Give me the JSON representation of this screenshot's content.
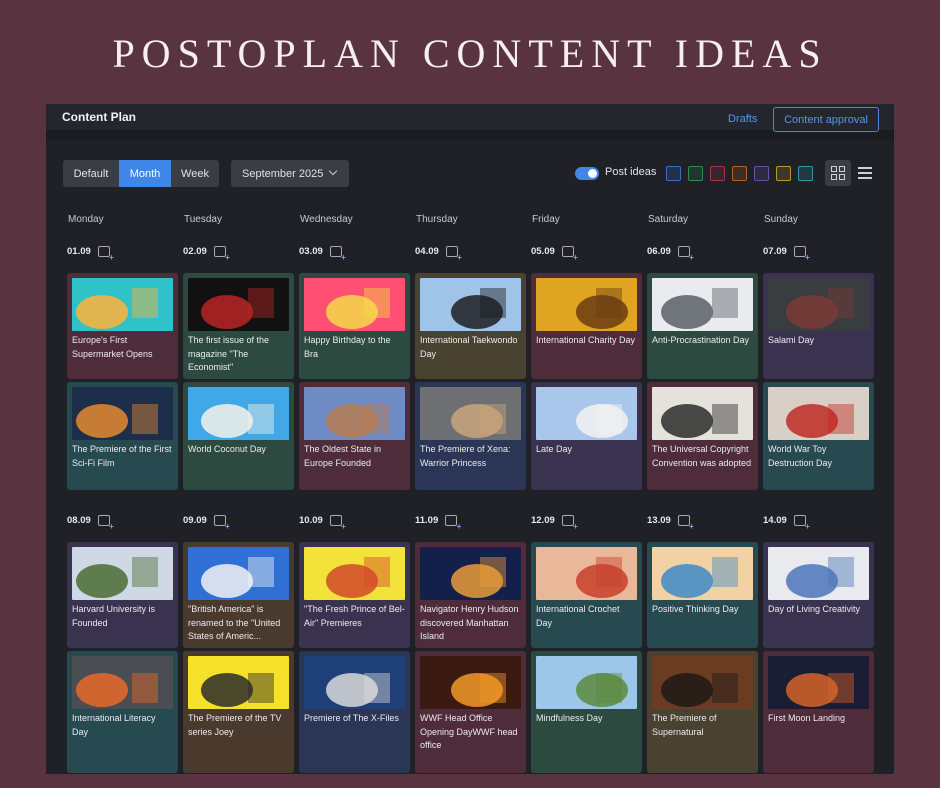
{
  "banner": {
    "text": "POSTOPLAN CONTENT IDEAS"
  },
  "header": {
    "title": "Content Plan",
    "drafts": "Drafts",
    "approval": "Content approval"
  },
  "toolbar": {
    "views": [
      "Default",
      "Month",
      "Week"
    ],
    "active_view": "Month",
    "month": "September 2025",
    "post_ideas_label": "Post ideas",
    "post_ideas_on": true,
    "swatches": [
      "#3a6fc4",
      "#2f8a4f",
      "#a33445",
      "#b4632f",
      "#6650a8",
      "#b89830",
      "#2e9aa8"
    ]
  },
  "days": [
    "Monday",
    "Tuesday",
    "Wednesday",
    "Thursday",
    "Friday",
    "Saturday",
    "Sunday"
  ],
  "weeks": [
    {
      "dates": [
        "01.09",
        "02.09",
        "03.09",
        "04.09",
        "05.09",
        "06.09",
        "07.09"
      ],
      "rows": [
        [
          {
            "text": "Europe's First Supermarket Opens",
            "color": "#4e2c3a",
            "img": [
              "#2fc3c9",
              "#ffb23a"
            ]
          },
          {
            "text": "The first issue of the magazine \"The Economist\"",
            "color": "#2d4a40",
            "img": [
              "#111111",
              "#b82424"
            ]
          },
          {
            "text": "Happy Birthday to the Bra",
            "color": "#2d4a40",
            "img": [
              "#ff4f72",
              "#f5d94a"
            ]
          },
          {
            "text": "International Taekwondo Day",
            "color": "#4a4230",
            "img": [
              "#9fc4e8",
              "#1d1f22"
            ]
          },
          {
            "text": "International Charity Day",
            "color": "#4e2c3a",
            "img": [
              "#e0a423",
              "#6b3d12"
            ]
          },
          {
            "text": "Anti-Procrastination Day",
            "color": "#2d4a40",
            "img": [
              "#e9ebef",
              "#5a5f66"
            ]
          },
          {
            "text": "Salami Day",
            "color": "#3a3350",
            "img": [
              "#3a3d40",
              "#7d3a35"
            ]
          }
        ],
        [
          {
            "text": "The Premiere of the First Sci-Fi Film",
            "color": "#274a50",
            "img": [
              "#1c2e4a",
              "#e58a32"
            ]
          },
          {
            "text": "World Coconut Day",
            "color": "#2d4a40",
            "img": [
              "#40a8e8",
              "#f4f1ea"
            ]
          },
          {
            "text": "The Oldest State in Europe Founded",
            "color": "#4e2c3a",
            "img": [
              "#6e8bc4",
              "#b87c55"
            ]
          },
          {
            "text": "The Premiere of Xena: Warrior Princess",
            "color": "#2b3556",
            "img": [
              "#6d6f72",
              "#c9a47d"
            ]
          },
          {
            "text": "Late Day",
            "color": "#3a3350",
            "img": [
              "#a9c7ea",
              "#f2f2f2"
            ]
          },
          {
            "text": "The Universal Copyright Convention was adopted",
            "color": "#4e2c3a",
            "img": [
              "#e5e2dc",
              "#2b2b2b"
            ]
          },
          {
            "text": "World War Toy Destruction Day",
            "color": "#274a50",
            "img": [
              "#d8cfc6",
              "#c02a24"
            ]
          }
        ]
      ]
    },
    {
      "dates": [
        "08.09",
        "09.09",
        "10.09",
        "11.09",
        "12.09",
        "13.09",
        "14.09"
      ],
      "rows": [
        [
          {
            "text": "Harvard University is Founded",
            "color": "#3a3350",
            "img": [
              "#cfd9e6",
              "#4b6b34"
            ]
          },
          {
            "text": "\"British America\" is renamed to the \"United States of Americ...",
            "color": "#4a3a2e",
            "img": [
              "#2f6fd6",
              "#f2f2f2"
            ]
          },
          {
            "text": "\"The Fresh Prince of Bel-Air\" Premieres",
            "color": "#3a3350",
            "img": [
              "#f2e23a",
              "#d24a2a"
            ]
          },
          {
            "text": "Navigator Henry Hudson discovered Manhattan Island",
            "color": "#4e2c3a",
            "img": [
              "#13214a",
              "#e99b3a"
            ]
          },
          {
            "text": "International Crochet Day",
            "color": "#274a50",
            "img": [
              "#e9b89a",
              "#c8402a"
            ]
          },
          {
            "text": "Positive Thinking Day",
            "color": "#274a50",
            "img": [
              "#f2d2a4",
              "#3e89c8"
            ]
          },
          {
            "text": "Day of Living Creativity",
            "color": "#3a3350",
            "img": [
              "#e8eaed",
              "#4c75b8"
            ]
          }
        ],
        [
          {
            "text": "International Literacy Day",
            "color": "#274a50",
            "img": [
              "#4a4d52",
              "#e86a2a"
            ]
          },
          {
            "text": "The Premiere of the TV series Joey",
            "color": "#4a3a2e",
            "img": [
              "#f5e12a",
              "#2b2b2b"
            ]
          },
          {
            "text": "Premiere of The X-Files",
            "color": "#2b3556",
            "img": [
              "#1f3f78",
              "#d9d9d9"
            ]
          },
          {
            "text": "WWF Head Office Opening DayWWF head office",
            "color": "#4e2c3a",
            "img": [
              "#3b1a12",
              "#f29a28"
            ]
          },
          {
            "text": "Mindfulness Day",
            "color": "#2d4a40",
            "img": [
              "#9cc7e8",
              "#5d8a3d"
            ]
          },
          {
            "text": "The Premiere of Supernatural",
            "color": "#4a4230",
            "img": [
              "#6b3b22",
              "#1e1a18"
            ]
          },
          {
            "text": "First Moon Landing",
            "color": "#4e2c3a",
            "img": [
              "#1a1d33",
              "#d6642a"
            ]
          }
        ]
      ]
    }
  ]
}
